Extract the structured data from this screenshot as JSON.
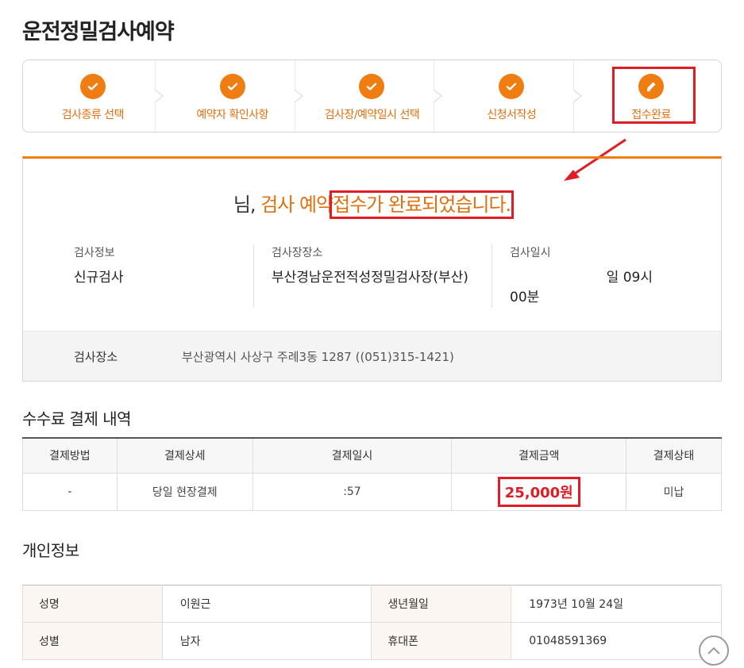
{
  "page": {
    "title": "운전정밀검사예약"
  },
  "steps": [
    {
      "label": "검사종류 선택",
      "icon": "check-icon"
    },
    {
      "label": "예약자 확인사항",
      "icon": "check-icon"
    },
    {
      "label": "검사장/예약일시 선택",
      "icon": "check-icon"
    },
    {
      "label": "신청서작성",
      "icon": "check-icon"
    },
    {
      "label": "접수완료",
      "icon": "pencil-icon"
    }
  ],
  "confirmation": {
    "name_suffix": "님,",
    "message_part1": " 검사 예약",
    "message_part2": "접수가 완료되었습니다.",
    "info": {
      "type_label": "검사정보",
      "type_value": "신규검사",
      "center_label": "검사장장소",
      "center_value": "부산경남운전적성정밀검사장(부산)",
      "datetime_label": "검사일시",
      "datetime_value_line1": "일 09시",
      "datetime_value_line2": "00분"
    },
    "place_label": "검사장소",
    "place_value": "부산광역시 사상구 주례3동 1287 ((051)315-1421)"
  },
  "fee": {
    "title": "수수료 결제 내역",
    "headers": [
      "결제방법",
      "결제상세",
      "결제일시",
      "결제금액",
      "결제상태"
    ],
    "row": {
      "method": "-",
      "detail": "당일 현장결제",
      "datetime": ":57",
      "amount": "25,000원",
      "status": "미납"
    }
  },
  "personal": {
    "title": "개인정보",
    "rows": [
      {
        "k1": "성명",
        "v1": "이원근",
        "k2": "생년월일",
        "v2": "1973년 10월 24일"
      },
      {
        "k1": "성별",
        "v1": "남자",
        "k2": "휴대폰",
        "v2": "01048591369"
      }
    ]
  },
  "colors": {
    "accent": "#f07d12",
    "highlight": "#e01c24"
  }
}
